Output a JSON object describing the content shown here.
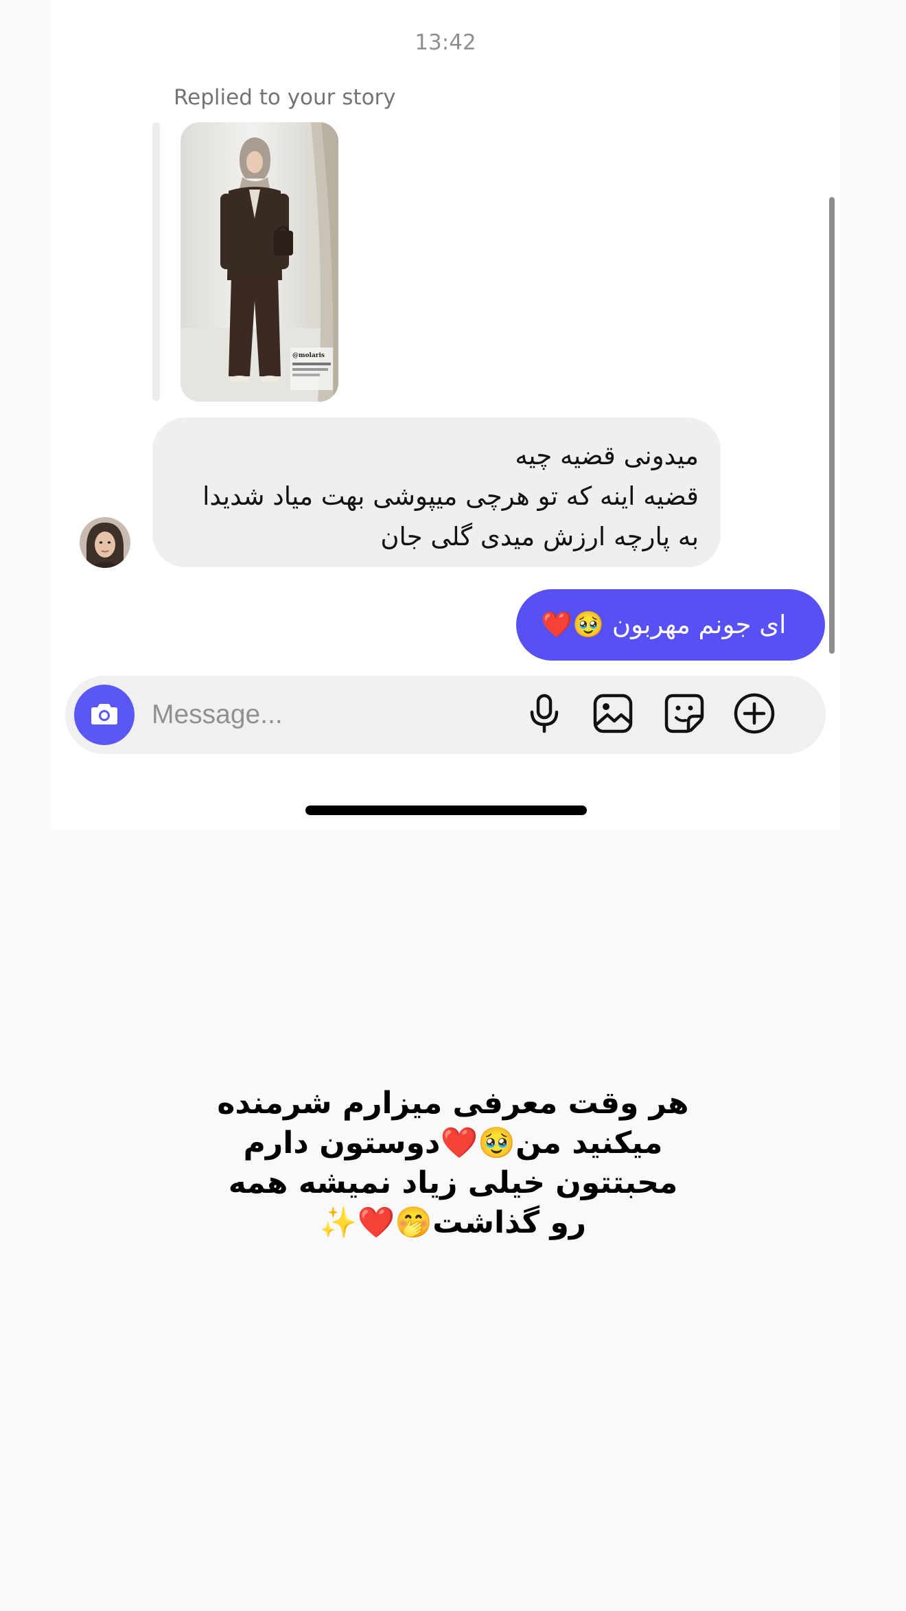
{
  "chat": {
    "timestamp": "13:42",
    "reply_label": "Replied to your story",
    "story_preview": {
      "watermark": "@molaris"
    },
    "incoming_message": {
      "lines": [
        "میدونی قضیه چیه",
        "قضیه اینه که تو هرچی میپوشی بهت میاد شدیدا",
        "به پارچه ارزش میدی گلی جان"
      ]
    },
    "outgoing_message": {
      "text": "ای جونم مهربون 🥹❤️"
    }
  },
  "composer": {
    "placeholder": "Message...",
    "icons": [
      "camera-icon",
      "microphone-icon",
      "gallery-icon",
      "sticker-icon",
      "plus-circle-icon"
    ],
    "accent_color": "#5751f4"
  },
  "caption": {
    "lines": [
      "هر وقت معرفی میزارم شرمنده",
      "میکنید من🥹❤️دوستون دارم",
      "محبتتون خیلی زیاد نمیشه همه",
      "رو گذاشت🤭❤️✨"
    ]
  }
}
